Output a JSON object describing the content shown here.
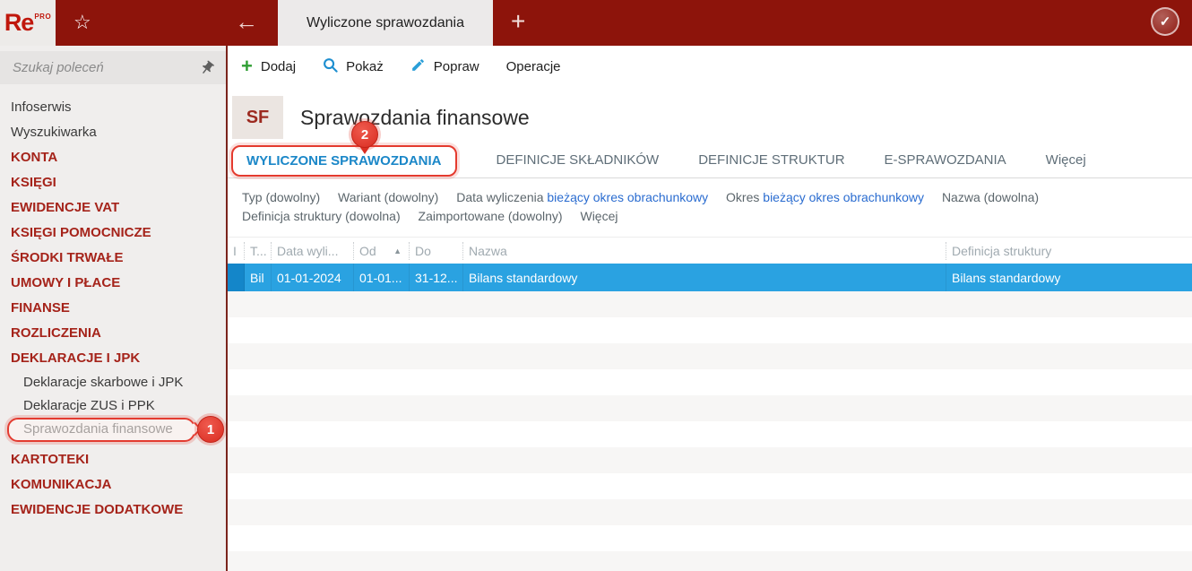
{
  "topbar": {
    "logo_text": "Re",
    "logo_sup": "PRO",
    "tab_title": "Wyliczone sprawozdania",
    "icons": {
      "star": "☆",
      "back": "←",
      "plus": "+",
      "check": "✓"
    }
  },
  "sidebar": {
    "search_placeholder": "Szukaj poleceń",
    "items": [
      {
        "label": "Infoserwis",
        "type": "plain"
      },
      {
        "label": "Wyszukiwarka",
        "type": "plain"
      },
      {
        "label": "KONTA",
        "type": "section"
      },
      {
        "label": "KSIĘGI",
        "type": "section"
      },
      {
        "label": "EWIDENCJE VAT",
        "type": "section"
      },
      {
        "label": "KSIĘGI POMOCNICZE",
        "type": "section"
      },
      {
        "label": "ŚRODKI TRWAŁE",
        "type": "section"
      },
      {
        "label": "UMOWY I PŁACE",
        "type": "section"
      },
      {
        "label": "FINANSE",
        "type": "section"
      },
      {
        "label": "ROZLICZENIA",
        "type": "section"
      },
      {
        "label": "DEKLARACJE I JPK",
        "type": "section"
      },
      {
        "label": "Deklaracje skarbowe i JPK",
        "type": "sub"
      },
      {
        "label": "Deklaracje ZUS i PPK",
        "type": "sub"
      },
      {
        "label": "Sprawozdania finansowe",
        "type": "sub",
        "annotated": true
      },
      {
        "label": "KARTOTEKI",
        "type": "section"
      },
      {
        "label": "KOMUNIKACJA",
        "type": "section"
      },
      {
        "label": "EWIDENCJE DODATKOWE",
        "type": "section"
      }
    ]
  },
  "toolbar": {
    "buttons": [
      {
        "label": "Dodaj",
        "icon": "plus-icon",
        "glyph": "+"
      },
      {
        "label": "Pokaż",
        "icon": "magnifier-icon"
      },
      {
        "label": "Popraw",
        "icon": "pencil-icon"
      },
      {
        "label": "Operacje"
      }
    ]
  },
  "header": {
    "badge": "SF",
    "title": "Sprawozdania finansowe"
  },
  "tabs": [
    {
      "label": "WYLICZONE SPRAWOZDANIA",
      "active": true
    },
    {
      "label": "DEFINICJE SKŁADNIKÓW"
    },
    {
      "label": "DEFINICJE STRUKTUR"
    },
    {
      "label": "E-SPRAWOZDANIA"
    },
    {
      "label": "Więcej"
    }
  ],
  "filters": {
    "line1": [
      {
        "label": "Typ (dowolny)"
      },
      {
        "label": "Wariant (dowolny)"
      },
      {
        "label": "Data wyliczenia",
        "value": "bieżący okres obrachunkowy"
      },
      {
        "label": "Okres",
        "value": "bieżący okres obrachunkowy"
      },
      {
        "label": "Nazwa (dowolna)"
      }
    ],
    "line2": [
      {
        "label": "Definicja struktury (dowolna)"
      },
      {
        "label": "Zaimportowane (dowolny)"
      },
      {
        "label": "Więcej"
      }
    ]
  },
  "table": {
    "sort_indicator": "▲",
    "columns": [
      {
        "label": "I"
      },
      {
        "label": "T..."
      },
      {
        "label": "Data wyli..."
      },
      {
        "label": "Od"
      },
      {
        "label": "Do"
      },
      {
        "label": "Nazwa"
      },
      {
        "label": "Definicja struktury"
      }
    ],
    "row": {
      "cells": [
        "",
        "Bil",
        "01-01-2024",
        "01-01...",
        "31-12...",
        "Bilans standardowy",
        "Bilans standardowy"
      ]
    }
  },
  "annotations": {
    "step1": "1",
    "step2": "2"
  },
  "colors": {
    "topbar_red": "#8d140b",
    "sidebar_section_red": "#a5231a",
    "annotation_red": "#e33b30",
    "selected_row_blue": "#2aa2e1",
    "selected_row_indicator_blue": "#1486c9",
    "active_tab_blue": "#1b87c8",
    "filter_value_blue": "#2a6cd0",
    "toolbar_plus_green": "#2f9e33"
  }
}
